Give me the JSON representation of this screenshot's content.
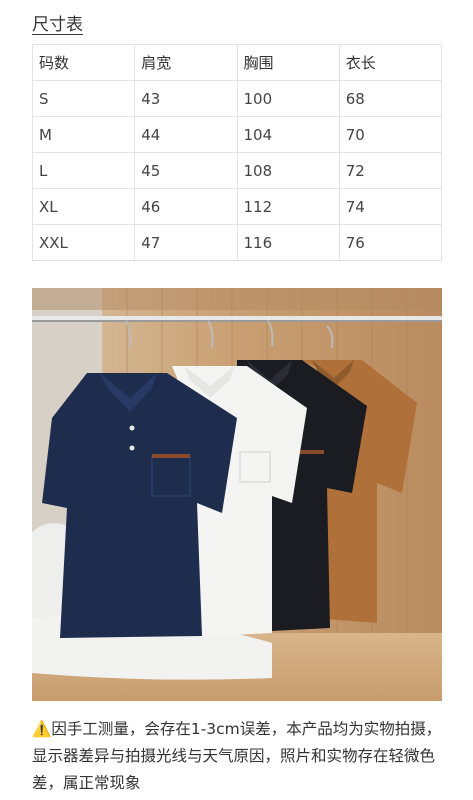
{
  "size_chart": {
    "title": "尺寸表",
    "headers": [
      "码数",
      "肩宽",
      "胸围",
      "衣长"
    ],
    "rows": [
      [
        "S",
        "43",
        "100",
        "68"
      ],
      [
        "M",
        "44",
        "104",
        "70"
      ],
      [
        "L",
        "45",
        "108",
        "72"
      ],
      [
        "XL",
        "46",
        "112",
        "74"
      ],
      [
        "XXL",
        "47",
        "116",
        "76"
      ]
    ]
  },
  "photo": {
    "shirts": [
      {
        "color_name": "navy",
        "color": "#1e2c4e"
      },
      {
        "color_name": "white",
        "color": "#f3f3f1"
      },
      {
        "color_name": "black",
        "color": "#1a1c22"
      },
      {
        "color_name": "camel",
        "color": "#b0703a"
      }
    ]
  },
  "note": {
    "icon": "warning-icon",
    "text": "因手工测量，会存在1-3cm误差，本产品均为实物拍摄，显示器差异与拍摄光线与天气原因，照片和实物存在轻微色差，属正常现象"
  }
}
